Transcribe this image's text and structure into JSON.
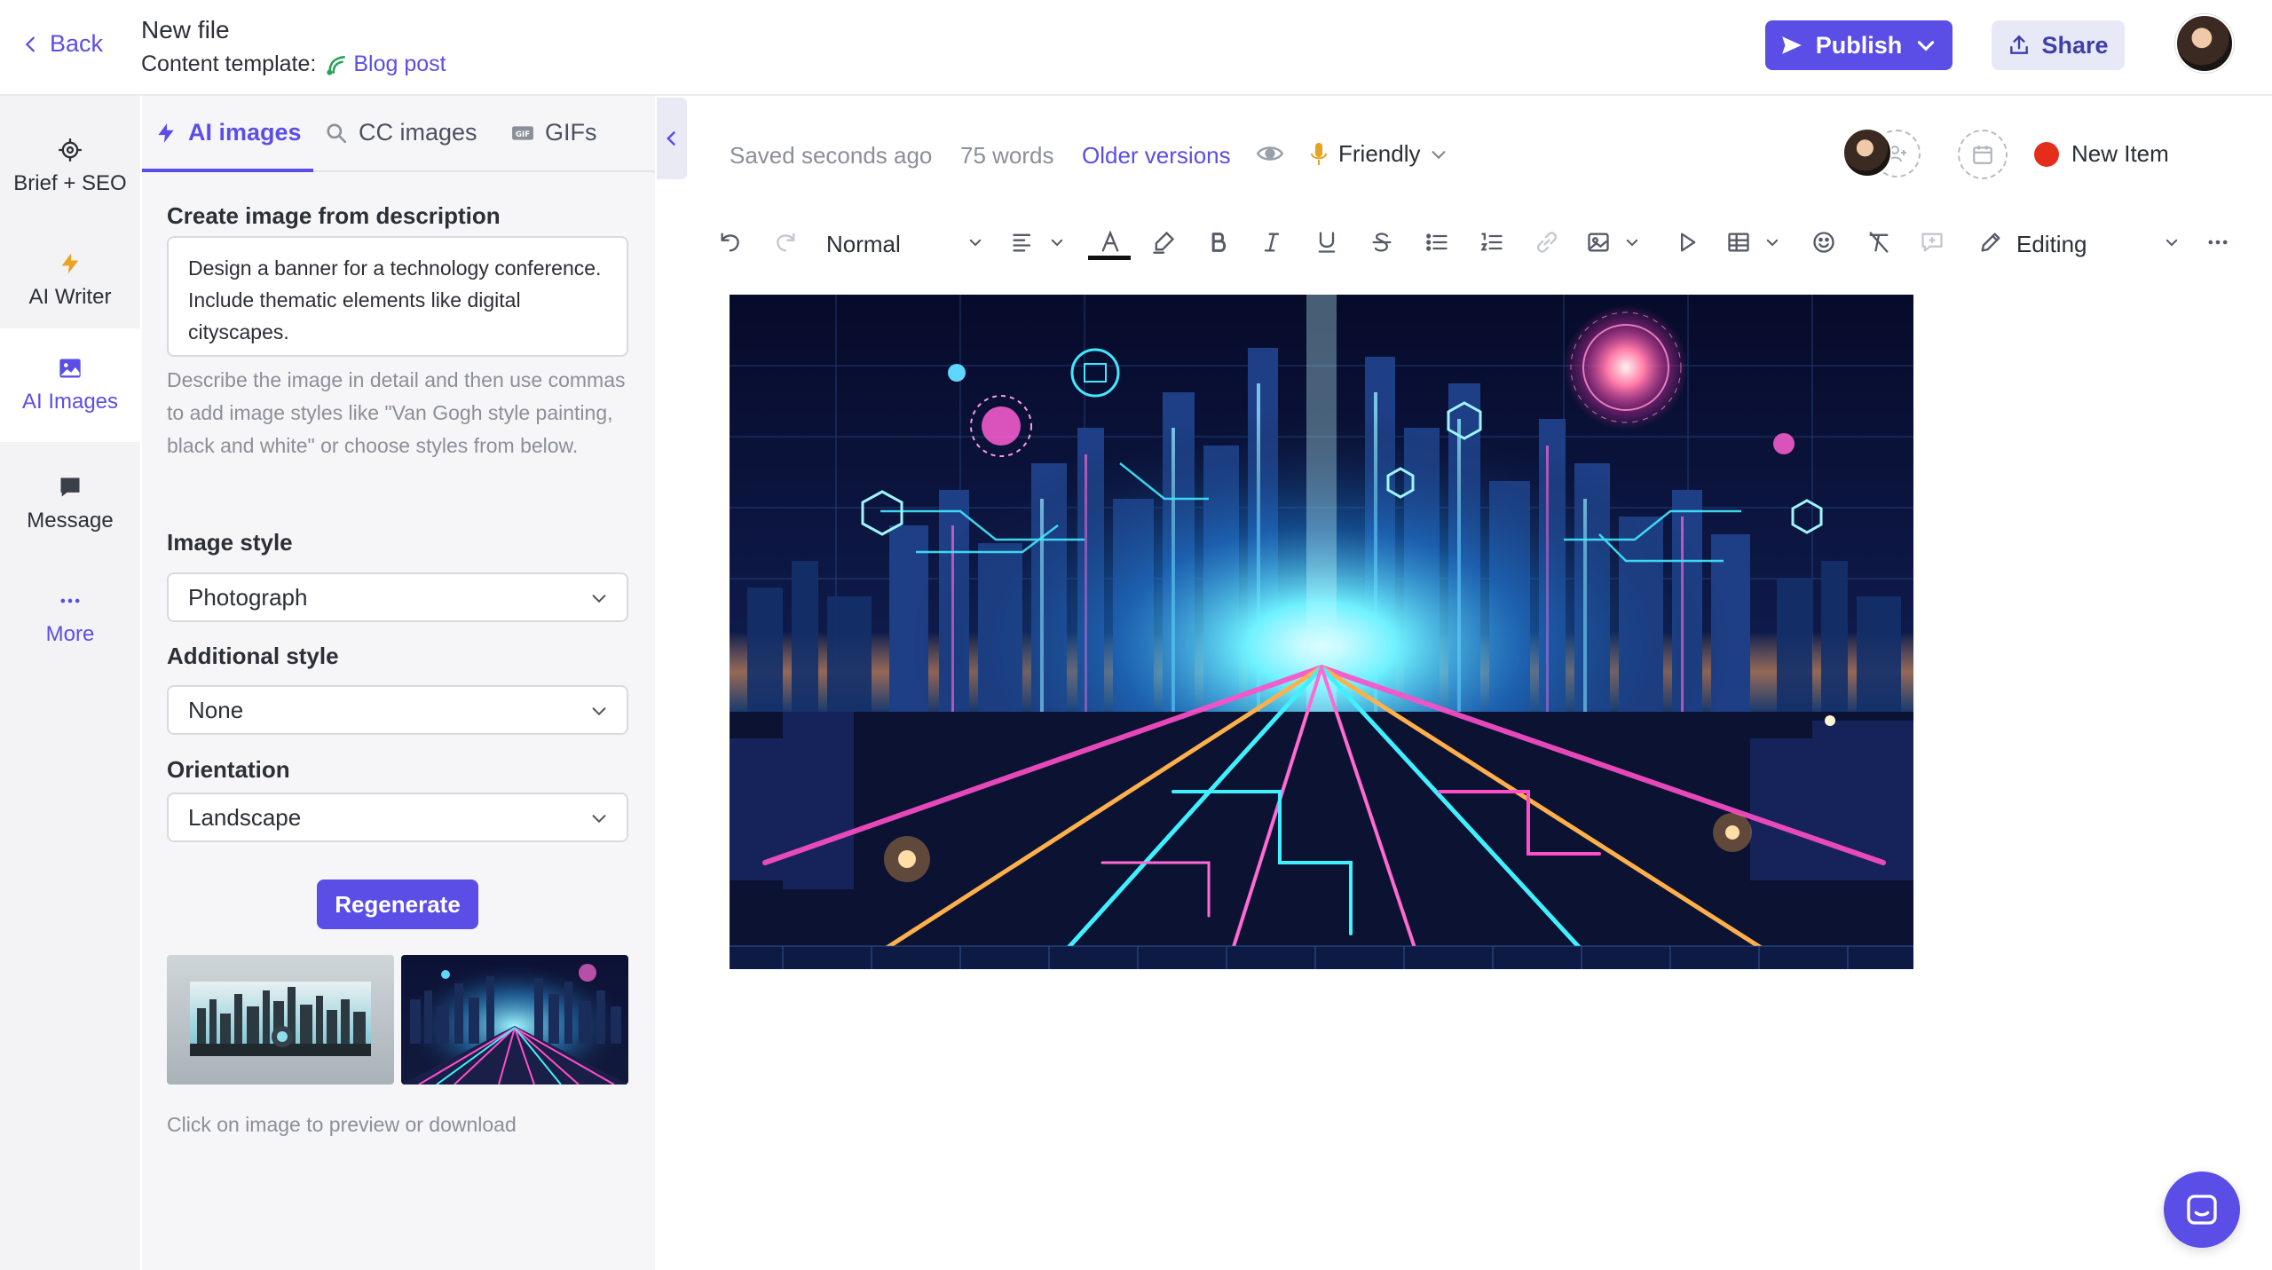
{
  "header": {
    "back_label": "Back",
    "file_title": "New file",
    "template_prefix": "Content template:",
    "template_name": "Blog post",
    "publish_label": "Publish",
    "share_label": "Share"
  },
  "rail": {
    "items": [
      {
        "label": "Brief + SEO",
        "icon": "target-icon"
      },
      {
        "label": "AI Writer",
        "icon": "lightning-icon"
      },
      {
        "label": "AI Images",
        "icon": "image-icon"
      },
      {
        "label": "Message",
        "icon": "message-icon"
      },
      {
        "label": "More",
        "icon": "ellipsis-icon"
      }
    ],
    "active": "AI Images"
  },
  "panel": {
    "tabs": [
      {
        "label": "AI images",
        "icon": "lightning-icon"
      },
      {
        "label": "CC images",
        "icon": "search-icon"
      },
      {
        "label": "GIFs",
        "icon": "gif-icon"
      }
    ],
    "active_tab": "AI images",
    "description_label": "Create image from description",
    "description_value": "Design a banner for a technology conference. Include thematic elements like digital cityscapes.",
    "hint": "Describe the image in detail and then use commas to add image styles like \"Van Gogh style painting, black and white\" or choose styles from below.",
    "image_style_label": "Image style",
    "image_style_value": "Photograph",
    "additional_style_label": "Additional style",
    "additional_style_value": "None",
    "orientation_label": "Orientation",
    "orientation_value": "Landscape",
    "regenerate_label": "Regenerate",
    "thumbnail_note": "Click on image to preview or download"
  },
  "editor": {
    "saved_status": "Saved seconds ago",
    "word_count": "75 words",
    "older_versions": "Older versions",
    "tone": "Friendly",
    "new_item": "New Item",
    "paragraph_style": "Normal",
    "mode": "Editing"
  },
  "colors": {
    "accent": "#5b4ee6",
    "new_item_dot": "#e52d1b",
    "tone_icon": "#e8a320"
  }
}
